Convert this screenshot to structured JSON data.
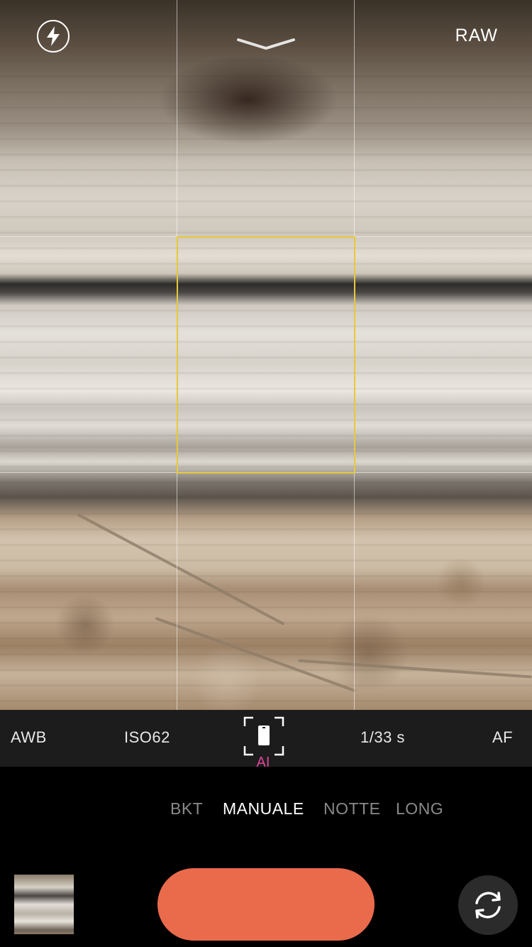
{
  "topbar": {
    "flash_icon": "lightning-bolt-icon",
    "chevron_icon": "chevron-down-icon",
    "raw_label": "RAW"
  },
  "settings": {
    "white_balance": "AWB",
    "iso": "ISO62",
    "mode_icon": "ai-scene-frame-icon",
    "ai_label": "AI",
    "shutter_speed": "1/33 s",
    "focus": "AF"
  },
  "modes": {
    "items": [
      {
        "label": "BKT",
        "active": false
      },
      {
        "label": "MANUALE",
        "active": true
      },
      {
        "label": "NOTTE",
        "active": false
      },
      {
        "label": "LONG",
        "active": false
      }
    ]
  },
  "controls": {
    "thumbnail_icon": "last-photo-thumbnail",
    "shutter_color": "#ea6a4c",
    "flip_icon": "camera-switch-icon"
  },
  "colors": {
    "focus_box": "#e6c93a",
    "ai_accent": "#e0459a"
  }
}
